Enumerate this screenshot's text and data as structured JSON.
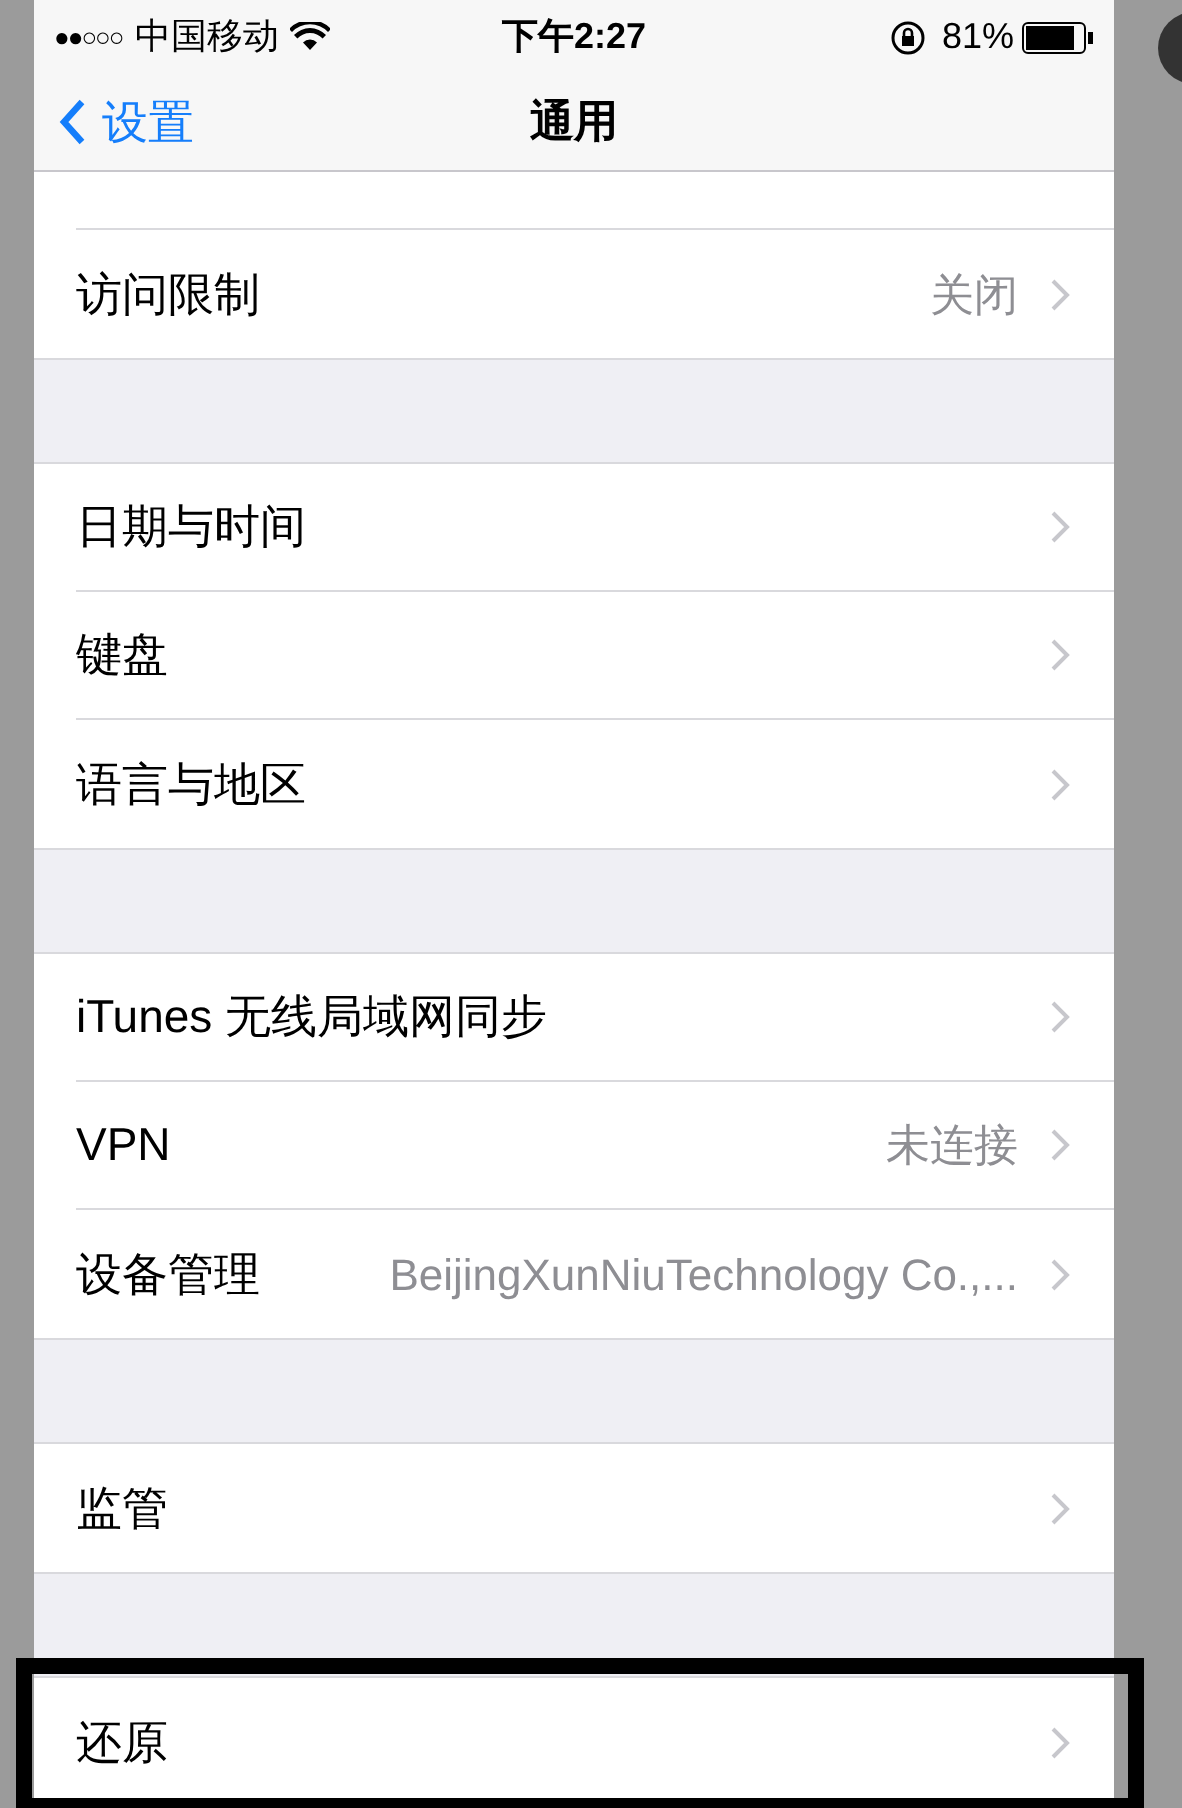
{
  "status_bar": {
    "signal": "●●○○○",
    "carrier": "中国移动",
    "time": "下午2:27",
    "battery": "81%"
  },
  "nav": {
    "back": "设置",
    "title": "通用"
  },
  "sections": [
    {
      "rows": [
        {
          "label": "访问限制",
          "value": "关闭",
          "highlighted": false
        }
      ]
    },
    {
      "rows": [
        {
          "label": "日期与时间",
          "highlighted": false
        },
        {
          "label": "键盘",
          "highlighted": false
        },
        {
          "label": "语言与地区",
          "highlighted": false
        }
      ]
    },
    {
      "rows": [
        {
          "label": "iTunes 无线局域网同步",
          "highlighted": false
        },
        {
          "label": "VPN",
          "value": "未连接",
          "highlighted": false
        },
        {
          "label": "设备管理",
          "value": "BeijingXunNiuTechnology Co.,...",
          "highlighted": false
        }
      ]
    },
    {
      "rows": [
        {
          "label": "监管",
          "highlighted": false
        }
      ]
    },
    {
      "rows": [
        {
          "label": "还原",
          "highlighted": true
        }
      ]
    }
  ]
}
